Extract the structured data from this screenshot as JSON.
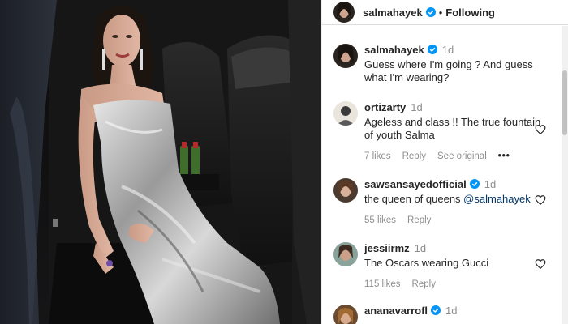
{
  "post": {
    "author": "salmahayek",
    "follow_label": "Following",
    "caption": "Guess where I'm going ? And guess what I'm wearing?",
    "caption_time": "1d"
  },
  "comments": [
    {
      "username": "ortizarty",
      "time": "1d",
      "text": "Ageless and class !! The true fountain of youth Salma",
      "likes": "7 likes",
      "reply_label": "Reply",
      "see_original_label": "See original",
      "more_label": "•••",
      "verified": false
    },
    {
      "username": "sawsansayedofficial",
      "time": "1d",
      "text_before": "the queen of queens ",
      "mention": "@salmahayek",
      "likes": "55 likes",
      "reply_label": "Reply",
      "verified": true
    },
    {
      "username": "jessiirmz",
      "time": "1d",
      "text": "The Oscars wearing Gucci",
      "likes": "115 likes",
      "reply_label": "Reply",
      "verified": false
    },
    {
      "username": "ananavarrofl",
      "time": "1d",
      "verified": true
    }
  ],
  "icons": {
    "verified": "verified-badge-icon",
    "like": "heart-icon",
    "more": "more-options-icon"
  },
  "colors": {
    "verified_blue": "#0095f6",
    "mention_blue": "#00376b",
    "muted_text": "#8e8e8e",
    "dress_silver": "#b8b8b8"
  }
}
